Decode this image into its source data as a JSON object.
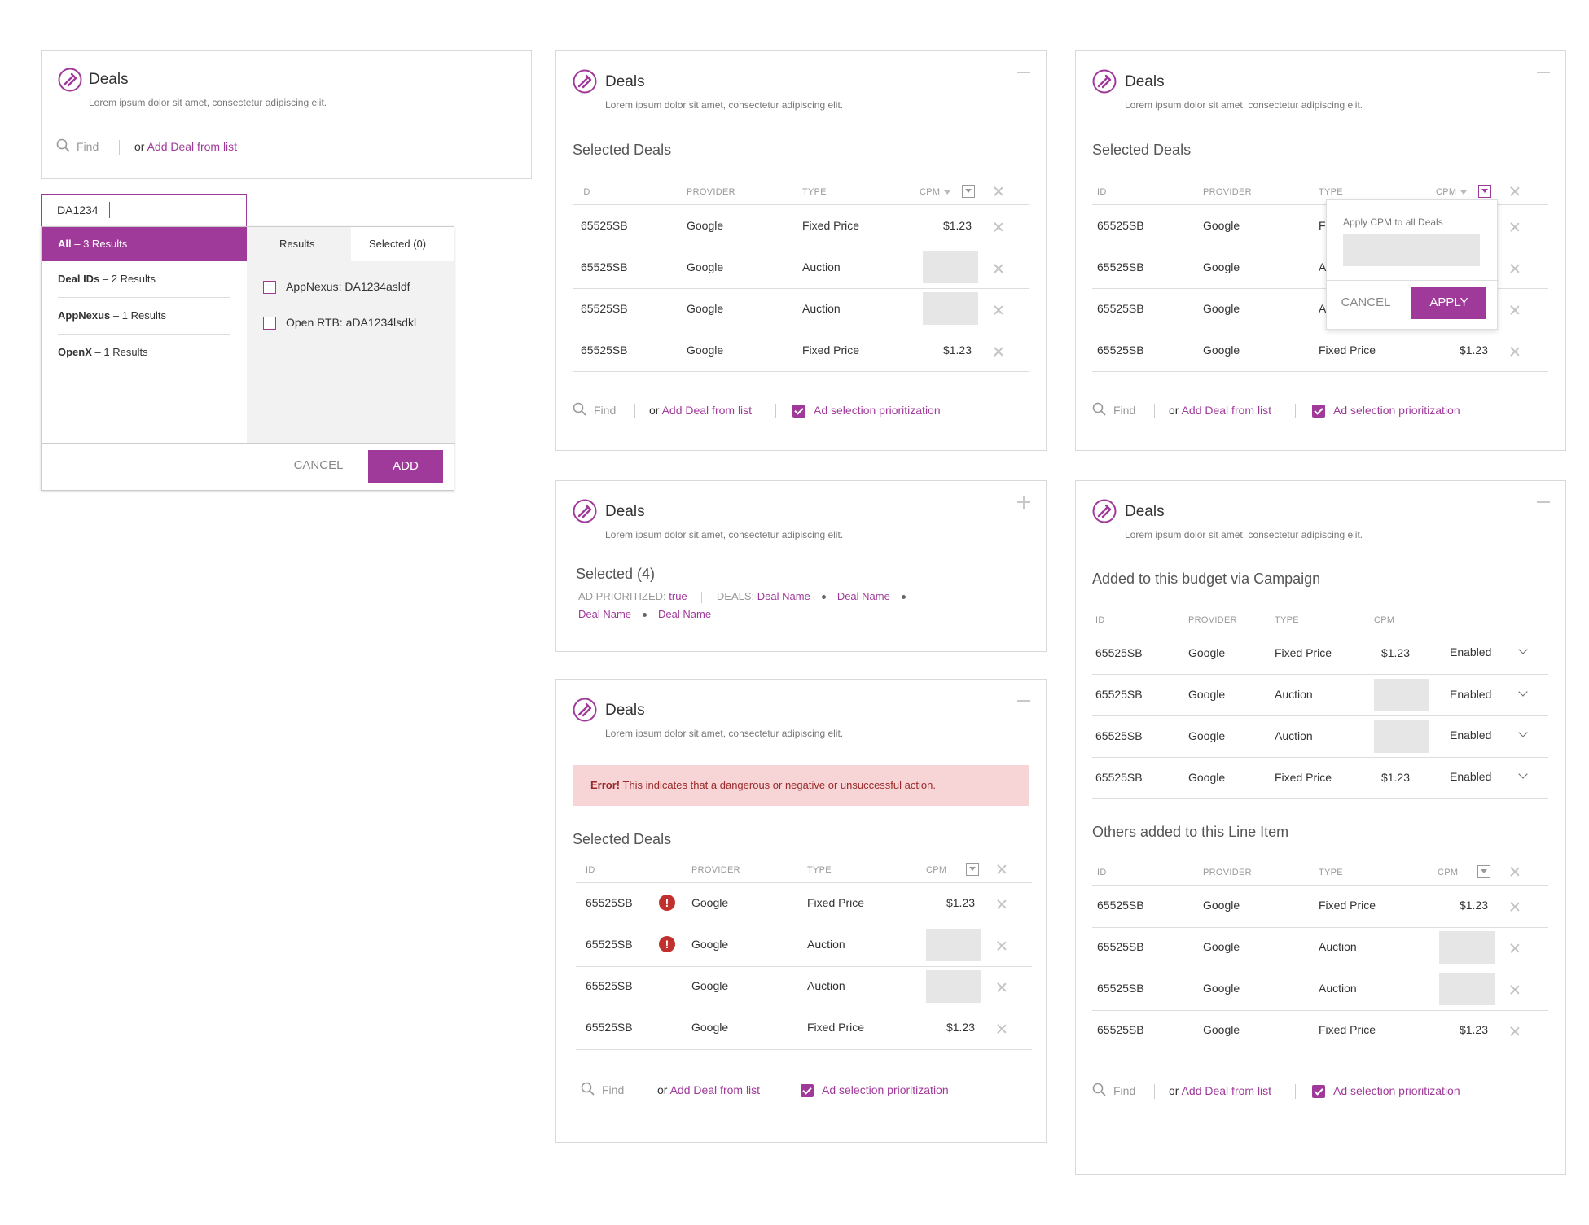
{
  "deals_title": "Deals",
  "lorem": "Lorem ipsum dolor sit amet, consectetur adipiscing elit.",
  "find_placeholder": "Find",
  "or_text": "or",
  "add_deal_link": "Add Deal from list",
  "ad_selection": "Ad selection prioritization",
  "selected_deals": "Selected Deals",
  "headers": {
    "id": "ID",
    "provider": "PROVIDER",
    "type": "TYPE",
    "cpm": "CPM"
  },
  "rows": [
    {
      "id": "65525SB",
      "provider": "Google",
      "type": "Fixed Price",
      "cpm": "$1.23"
    },
    {
      "id": "65525SB",
      "provider": "Google",
      "type": "Auction",
      "cpm": ""
    },
    {
      "id": "65525SB",
      "provider": "Google",
      "type": "Auction",
      "cpm": ""
    },
    {
      "id": "65525SB",
      "provider": "Google",
      "type": "Fixed Price",
      "cpm": "$1.23"
    }
  ],
  "search_panel": {
    "query": "DA1234",
    "categories": [
      {
        "name": "All",
        "count": "3 Results"
      },
      {
        "name": "Deal IDs",
        "count": "2 Results"
      },
      {
        "name": "AppNexus",
        "count": "1 Results"
      },
      {
        "name": "OpenX",
        "count": "1 Results"
      }
    ],
    "dash": " – ",
    "tab_results": "Results",
    "tab_selected": "Selected (0)",
    "results": [
      "AppNexus: DA1234asldf",
      "Open RTB: aDA1234lsdkl"
    ],
    "cancel": "CANCEL",
    "add": "ADD"
  },
  "cpm_popover": {
    "label": "Apply CPM to all Deals",
    "cancel": "CANCEL",
    "apply": "APPLY",
    "partial_types": [
      "Fi",
      "A",
      "A"
    ]
  },
  "summary": {
    "selected": "Selected (4)",
    "ad_prioritized_label": "AD PRIORITIZED:",
    "ad_prioritized_value": "true",
    "deals_label": "DEALS:",
    "deal_names": [
      "Deal Name",
      "Deal Name",
      "Deal Name",
      "Deal Name"
    ]
  },
  "error": {
    "label": "Error!",
    "message": " This indicates that a dangerous or negative or unsuccessful action."
  },
  "campaign_section": "Added to this budget via Campaign",
  "line_item_section": "Others added to this Line Item",
  "status_value": "Enabled",
  "colors": {
    "accent": "#a03a9a",
    "error_bg": "#f7d4d6",
    "error_text": "#9a2a2a"
  }
}
